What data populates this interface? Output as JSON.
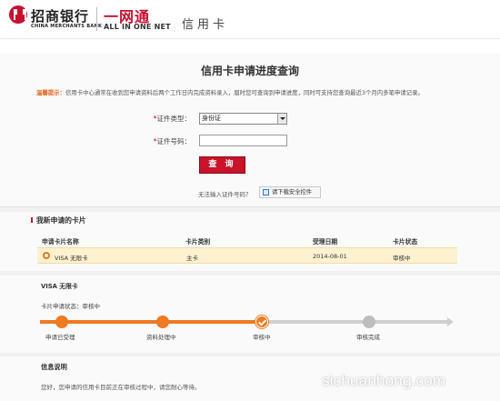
{
  "header": {
    "bank_name_cn": "招商银行",
    "bank_name_en": "CHINA MERCHANTS BANK",
    "aion_cn": "一网通",
    "aion_en": "ALL IN ONE NET",
    "section": "信用卡",
    "brand_color": "#c8102e"
  },
  "query": {
    "title": "信用卡申请进度查询",
    "tip_label": "温馨提示：",
    "tip_text": "信用卡中心通常在收到您申请资料后两个工作日内完成资料录入，届时您可查询到申请进度，同时可支持您查询最近3个月内多笔申请记录。",
    "id_type_label": "证件类型：",
    "id_type_value": "身份证",
    "id_number_label": "证件号码：",
    "id_number_value": "",
    "submit_label": "查 询",
    "cannot_input_text": "无法输入证件号码？",
    "download_label": "请下载安全控件"
  },
  "applications": {
    "title": "我新申请的卡片",
    "columns": [
      "申请卡片名称",
      "卡片类别",
      "受理日期",
      "卡片状态"
    ],
    "rows": [
      {
        "name": "VISA 无限卡",
        "category": "主卡",
        "date": "2014-08-01",
        "status": "审核中"
      }
    ]
  },
  "progress": {
    "card_name": "VISA 无限卡",
    "status_text": "卡片申请状态：审核中",
    "steps": [
      "申请已受理",
      "资料处理中",
      "审核中",
      "审核完成"
    ],
    "current_step": 3,
    "done_color": "#ee7a22",
    "pending_color": "#bdbdbd"
  },
  "info": {
    "title": "信息说明",
    "text": "您好，您申请的信用卡目前正在审核过程中，请您耐心等待。"
  },
  "watermark": "sichuanhong.com"
}
